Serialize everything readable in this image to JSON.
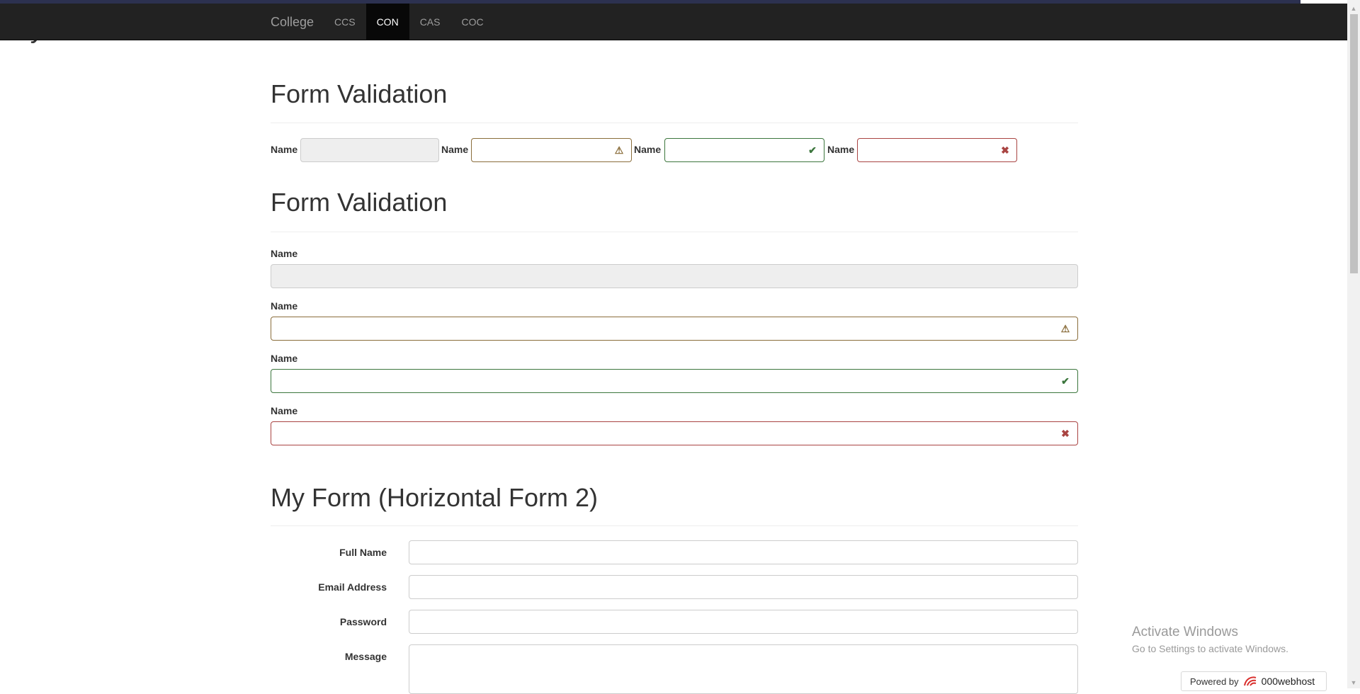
{
  "navbar": {
    "brand": "College",
    "items": [
      {
        "label": "CCS",
        "active": false
      },
      {
        "label": "CON",
        "active": true
      },
      {
        "label": "CAS",
        "active": false
      },
      {
        "label": "COC",
        "active": false
      }
    ]
  },
  "behind_text": "taily",
  "section1": {
    "title": "Form Validation",
    "fields": [
      {
        "label": "Name",
        "state": "disabled"
      },
      {
        "label": "Name",
        "state": "warning",
        "icon": "warning-icon"
      },
      {
        "label": "Name",
        "state": "success",
        "icon": "check-icon"
      },
      {
        "label": "Name",
        "state": "error",
        "icon": "x-icon"
      }
    ]
  },
  "section2": {
    "title": "Form Validation",
    "fields": [
      {
        "label": "Name",
        "state": "disabled"
      },
      {
        "label": "Name",
        "state": "warning",
        "icon": "warning-icon"
      },
      {
        "label": "Name",
        "state": "success",
        "icon": "check-icon"
      },
      {
        "label": "Name",
        "state": "error",
        "icon": "x-icon"
      }
    ]
  },
  "section3": {
    "title": "My Form (Horizontal Form 2)",
    "fields": [
      {
        "label": "Full Name",
        "value": ""
      },
      {
        "label": "Email Address",
        "value": ""
      },
      {
        "label": "Password",
        "value": ""
      },
      {
        "label": "Message",
        "value": ""
      }
    ]
  },
  "icons": {
    "warning": "⚠",
    "success": "✔",
    "error": "✖"
  },
  "colors": {
    "navbar_bg": "#222222",
    "warning": "#8a6d3b",
    "success": "#3c763d",
    "error": "#a94442"
  },
  "watermark": {
    "title": "Activate Windows",
    "subtitle": "Go to Settings to activate Windows."
  },
  "badge": {
    "powered_by": "Powered by",
    "name": "000webhost"
  }
}
